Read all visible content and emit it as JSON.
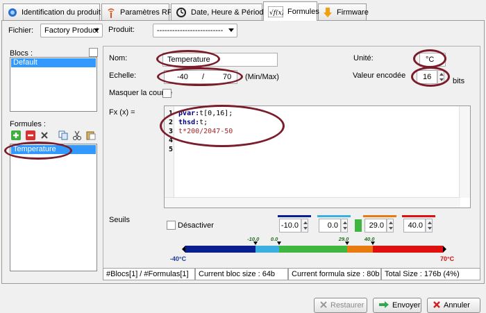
{
  "tabs": [
    {
      "label": "Identification du produit",
      "icon": "ident-icon"
    },
    {
      "label": "Paramètres RF",
      "icon": "rf-antenna-icon"
    },
    {
      "label": "Date, Heure & Périodes",
      "icon": "clock-icon"
    },
    {
      "label": "Formules",
      "icon": "formula-icon",
      "active": true
    },
    {
      "label": "Firmware",
      "icon": "download-arrow-icon"
    }
  ],
  "fichier": {
    "label": "Fichier:",
    "value": "Factory Product"
  },
  "produit": {
    "label": "Produit:",
    "value": "--------------------------"
  },
  "blocs": {
    "label": "Blocs :",
    "items": [
      "Default"
    ]
  },
  "formules": {
    "label": "Formules :",
    "items": [
      "Temperature"
    ]
  },
  "nom": {
    "label": "Nom:",
    "value": "Temperature"
  },
  "unite": {
    "label": "Unité:",
    "value": "°C"
  },
  "echelle": {
    "label": "Echelle:",
    "min": "-40",
    "sep": "/",
    "max": "70",
    "suffix": "(Min/Max)"
  },
  "valeur_encodee": {
    "label": "Valeur encodée",
    "value": "16",
    "unit": "bits"
  },
  "masquer": {
    "label": "Masquer la courbe"
  },
  "fx": {
    "label": "Fx (x) =",
    "lines": [
      {
        "num": "1",
        "kw": "pvar:",
        "rest": "t[0,16];"
      },
      {
        "num": "2",
        "kw": "thsd:",
        "rest": "t;"
      },
      {
        "num": "3",
        "kw": "",
        "rest": "t*200/2047-50"
      },
      {
        "num": "4",
        "kw": "",
        "rest": ""
      },
      {
        "num": "5",
        "kw": "",
        "rest": ""
      }
    ]
  },
  "seuils": {
    "label": "Seuils",
    "desactiver": "Désactiver",
    "values": [
      {
        "value": "-10.0",
        "color": "#0a1f8f"
      },
      {
        "value": "0.0",
        "color": "#3ab0e0"
      },
      {
        "value": "29.0",
        "color": "#e87a10"
      },
      {
        "value": "40.0",
        "color": "#e01010"
      }
    ],
    "bar_min": "-40°C",
    "bar_max": "70°C",
    "ticks": [
      "-10.0",
      "0.0",
      "29.0",
      "40.0"
    ],
    "scale": {
      "min": -40,
      "max": 70,
      "thresholds": [
        -10,
        0,
        29,
        40
      ],
      "segment_colors": [
        "#0a1f8f",
        "#3ab0e0",
        "#3fb63f",
        "#e87a10",
        "#e01010"
      ]
    }
  },
  "status": [
    "#Blocs[1] / #Formulas[1]",
    "Current bloc size : 64b",
    "Current formula size : 80b",
    "Total Size : 176b (4%)"
  ],
  "buttons": {
    "restaurer": "Restaurer",
    "envoyer": "Envoyer",
    "annuler": "Annuler"
  },
  "colors": {
    "annotation": "#7a1c2a",
    "selection": "#3399ff",
    "keyword": "#00007f",
    "expr": "#a0282a"
  }
}
